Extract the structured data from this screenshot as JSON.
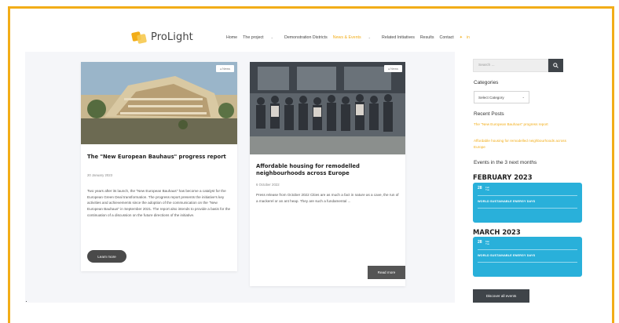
{
  "brand": {
    "name": "ProLight",
    "accent": "#f2ad18",
    "event_color": "#29b0da"
  },
  "nav": {
    "items": [
      {
        "label": "Home",
        "dropdown": false,
        "active": false
      },
      {
        "label": "The project",
        "dropdown": true,
        "active": false
      },
      {
        "label": "Demonstration Districts",
        "dropdown": false,
        "active": false
      },
      {
        "label": "News & Events",
        "dropdown": true,
        "active": true
      },
      {
        "label": "Related Initiatives",
        "dropdown": false,
        "active": false
      },
      {
        "label": "Results",
        "dropdown": false,
        "active": false
      },
      {
        "label": "Contact",
        "dropdown": false,
        "active": false
      }
    ],
    "social": [
      "twitter-icon",
      "linkedin-icon"
    ]
  },
  "posts": [
    {
      "tag": "News",
      "title": "The \"New European Bauhaus\" progress report",
      "date": "20 January 2023",
      "excerpt": "Two years after its launch, the \"New European Bauhaus\" has become a catalyst for the European Green Deal transformation. The progress report presents the initiative's key activities and achievements since the adoption of the communication on the \"New European Bauhaus\" in September 2021. The report also intends to provide a basis for the continuation of a discussion on the future directions of the initiative.",
      "button": "Learn more"
    },
    {
      "tag": "News",
      "title": "Affordable housing for remodelled neighbourhoods across Europe",
      "date": "6 October 2022",
      "excerpt": "Press release from October 2022 Cities are as much a fact in nature as a cave, the run of a mackerel or an ant heap. They are such a fundamental ...",
      "button": "Read more"
    }
  ],
  "sidebar": {
    "search_placeholder": "Search ...",
    "categories_heading": "Categories",
    "category_select": "Select Category",
    "recent_heading": "Recent Posts",
    "recent_posts": [
      "The \"New European Bauhaus\" progress report",
      "Affordable housing for remodelled neighbourhoods across Europe"
    ],
    "events_heading": "Events in the 3 next months",
    "months": [
      {
        "name": "FEBRUARY 2023",
        "day": "28",
        "mon": "Feb",
        "dow": "Tue",
        "title": "WORLD SUSTAINABLE ENERGY DAYS"
      },
      {
        "name": "MARCH 2023",
        "day": "28",
        "mon": "Mar",
        "dow": "Tue",
        "title": "WORLD SUSTAINABLE ENERGY DAYS"
      }
    ],
    "discover_button": "Discover all events"
  }
}
